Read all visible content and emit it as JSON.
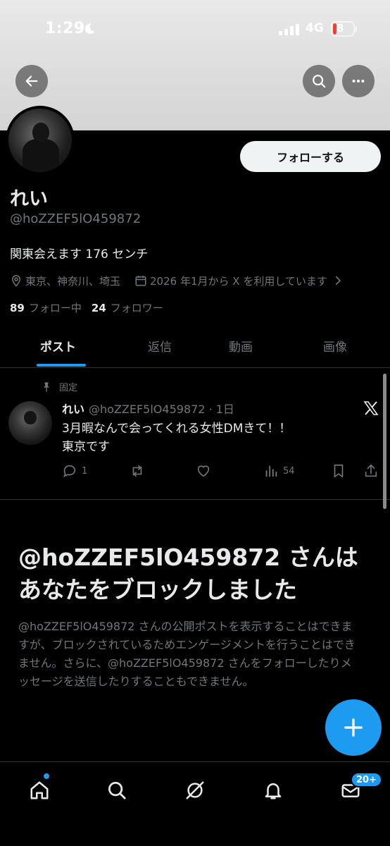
{
  "status_bar": {
    "time": "1:29",
    "network": "4G",
    "battery": "8"
  },
  "profile": {
    "display_name": "れい",
    "handle": "@hoZZEF5lO459872",
    "bio": "関東会えます 176 センチ",
    "location": "東京、神奈川、埼玉",
    "joined": "2026 年1月から X を利用しています",
    "following_count": "89",
    "following_label": "フォロー中",
    "followers_count": "24",
    "followers_label": "フォロワー",
    "follow_button": "フォローする"
  },
  "tabs": [
    {
      "label": "ポスト",
      "active": true
    },
    {
      "label": "返信",
      "active": false
    },
    {
      "label": "動画",
      "active": false
    },
    {
      "label": "画像",
      "active": false
    }
  ],
  "pinned_post": {
    "pinned_label": "固定",
    "author_name": "れい",
    "author_handle_time": "@hoZZEF5lO459872 · 1日",
    "text_line1": "3月暇なんで会ってくれる女性DMきて！！",
    "text_line2": "東京です",
    "reply_count": "1",
    "repost_count": "",
    "like_count": "",
    "view_count": "54"
  },
  "blocked_notice": {
    "title": "@hoZZEF5lO459872 さんはあなたをブロックしました",
    "body": "@hoZZEF5lO459872 さんの公開ポストを表示することはできますが、ブロックされているためエンゲージメントを行うことはできません。さらに、@hoZZEF5lO459872 さんをフォローしたりメッセージを送信したりすることもできません。"
  },
  "bottom_nav": {
    "messages_badge": "20+"
  },
  "colors": {
    "accent": "#1d9bf0",
    "background": "#000000",
    "text_primary": "#e7e9ea",
    "text_secondary": "#71767b"
  },
  "icons": [
    "back-arrow-icon",
    "search-icon",
    "more-icon",
    "location-icon",
    "calendar-icon",
    "chevron-right-icon",
    "pin-icon",
    "x-logo-icon",
    "reply-icon",
    "repost-icon",
    "like-icon",
    "views-icon",
    "bookmark-icon",
    "share-icon",
    "plus-icon",
    "home-icon",
    "grok-icon",
    "bell-icon",
    "mail-icon"
  ]
}
